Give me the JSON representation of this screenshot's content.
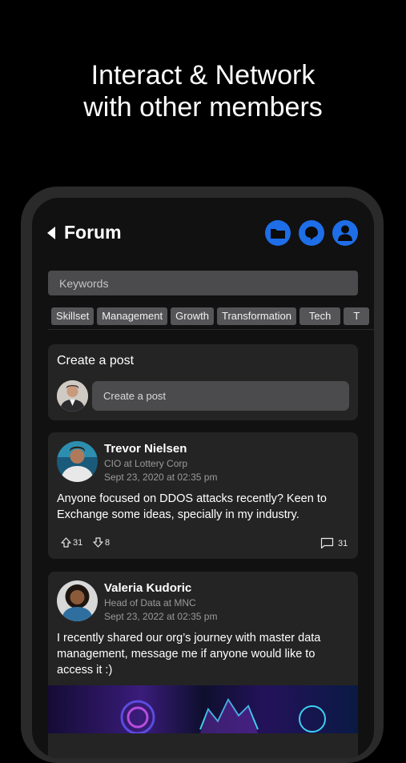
{
  "headline": {
    "line1": "Interact & Network",
    "line2": "with other members"
  },
  "header": {
    "title": "Forum",
    "icons": [
      "folder-icon",
      "chat-icon",
      "profile-icon"
    ]
  },
  "search": {
    "placeholder": "Keywords"
  },
  "chips": [
    "Skillset",
    "Management",
    "Growth",
    "Transformation",
    "Tech",
    "T"
  ],
  "create_post": {
    "title": "Create a post",
    "input_label": "Create a post"
  },
  "posts": [
    {
      "author": "Trevor Nielsen",
      "role": "CIO at Lottery Corp",
      "time": "Sept 23, 2020 at 02:35 pm",
      "text": "Anyone focused on DDOS attacks recently? Keen to Exchange some ideas, specially in my industry.",
      "upvotes": "31",
      "downvotes": "8",
      "comments": "31"
    },
    {
      "author": "Valeria Kudoric",
      "role": "Head of Data at MNC",
      "time": "Sept 23, 2022 at 02:35 pm",
      "text": "I recently shared our org’s journey with master data management, message me if anyone would like to access it :)"
    }
  ],
  "colors": {
    "accent": "#1e6ee8",
    "card": "#242424",
    "screen": "#111111",
    "input": "#4b4b4d"
  }
}
